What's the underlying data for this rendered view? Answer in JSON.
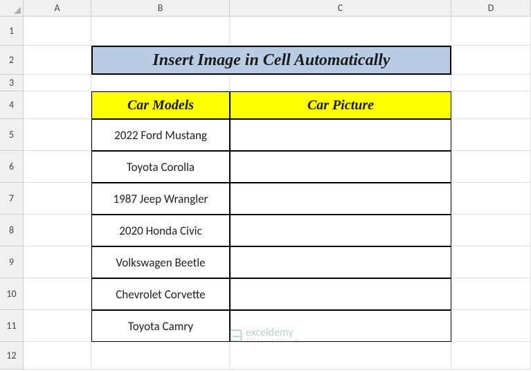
{
  "columns": [
    "A",
    "B",
    "C",
    "D"
  ],
  "rows": [
    "1",
    "2",
    "3",
    "4",
    "5",
    "6",
    "7",
    "8",
    "9",
    "10",
    "11",
    "12"
  ],
  "title": "Insert Image in Cell Automatically",
  "headers": {
    "b": "Car Models",
    "c": "Car Picture"
  },
  "data": [
    "2022 Ford Mustang",
    "Toyota Corolla",
    "1987 Jeep Wrangler",
    "2020 Honda Civic",
    "Volkswagen Beetle",
    "Chevrolet Corvette",
    "Toyota Camry"
  ],
  "watermark": {
    "main": "exceldemy",
    "sub": "EXCEL · DATA · BI"
  }
}
